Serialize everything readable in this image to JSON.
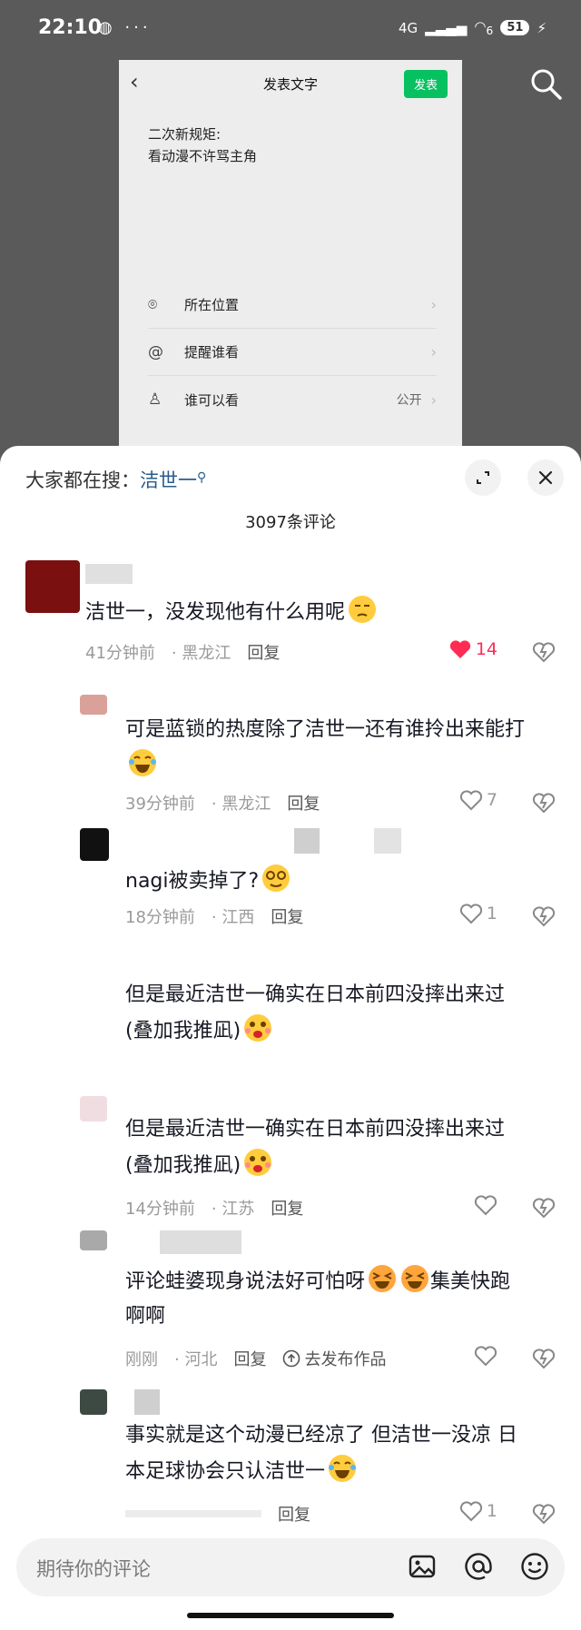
{
  "status_bar": {
    "time": "22:10",
    "extra_icons": "◍ ···",
    "network": "4G",
    "wifi": "6",
    "battery": "51"
  },
  "background_post": {
    "title": "发表文字",
    "send_label": "发表",
    "text_line1": "二次新规矩:",
    "text_line2": "看动漫不许骂主角",
    "rows": [
      {
        "label": "所在位置",
        "value": ""
      },
      {
        "label": "提醒谁看",
        "value": ""
      },
      {
        "label": "谁可以看",
        "value": "公开"
      }
    ]
  },
  "sheet": {
    "search_prefix": "大家都在搜：",
    "search_term": "洁世一",
    "comment_count": "3097条评论"
  },
  "comments": [
    {
      "line1": "洁世一，没发现他有什么用呢",
      "line2": "",
      "time": "41分钟前",
      "region": "黑龙江",
      "reply": "回复",
      "likes": "14",
      "liked": true
    },
    {
      "line1": "可是蓝锁的热度除了洁世一还有谁拎出来能打",
      "line2": "",
      "time": "39分钟前",
      "region": "黑龙江",
      "reply": "回复",
      "likes": "7",
      "liked": false
    },
    {
      "line1": "nagi被卖掉了?",
      "line2": "",
      "time": "18分钟前",
      "region": "江西",
      "reply": "回复",
      "likes": "1",
      "liked": false
    },
    {
      "line1": "但是最近洁世一确实在日本前四没摔出来过",
      "line2": "(叠加我推凪)",
      "time": "",
      "region": "",
      "reply": "",
      "likes": "",
      "liked": false
    },
    {
      "line1": "但是最近洁世一确实在日本前四没摔出来过",
      "line2": "(叠加我推凪)",
      "time": "14分钟前",
      "region": "江苏",
      "reply": "回复",
      "likes": "",
      "liked": false
    },
    {
      "line1": "评论蛙婆现身说法好可怕呀",
      "line1_tail": "集美快跑",
      "line2": "啊啊",
      "time": "刚刚",
      "region": "河北",
      "reply": "回复",
      "post_work": "去发布作品",
      "likes": "",
      "liked": false
    },
    {
      "line1": "事实就是这个动漫已经凉了 但洁世一没凉 日",
      "line2": "本足球协会只认洁世一",
      "time": "",
      "region": "",
      "reply": "回复",
      "likes": "1",
      "liked": false
    }
  ],
  "input": {
    "placeholder": "期待你的评论"
  },
  "icons": [
    "search-icon",
    "expand-icon",
    "close-icon",
    "heart-icon",
    "dislike-heart-icon",
    "image-icon",
    "at-icon",
    "emoji-icon",
    "location-icon",
    "mention-icon",
    "person-icon",
    "back-icon"
  ],
  "colors": {
    "liked_heart": "#fe2c55",
    "send_button": "#07c160",
    "search_term": "#2a5c8a"
  }
}
